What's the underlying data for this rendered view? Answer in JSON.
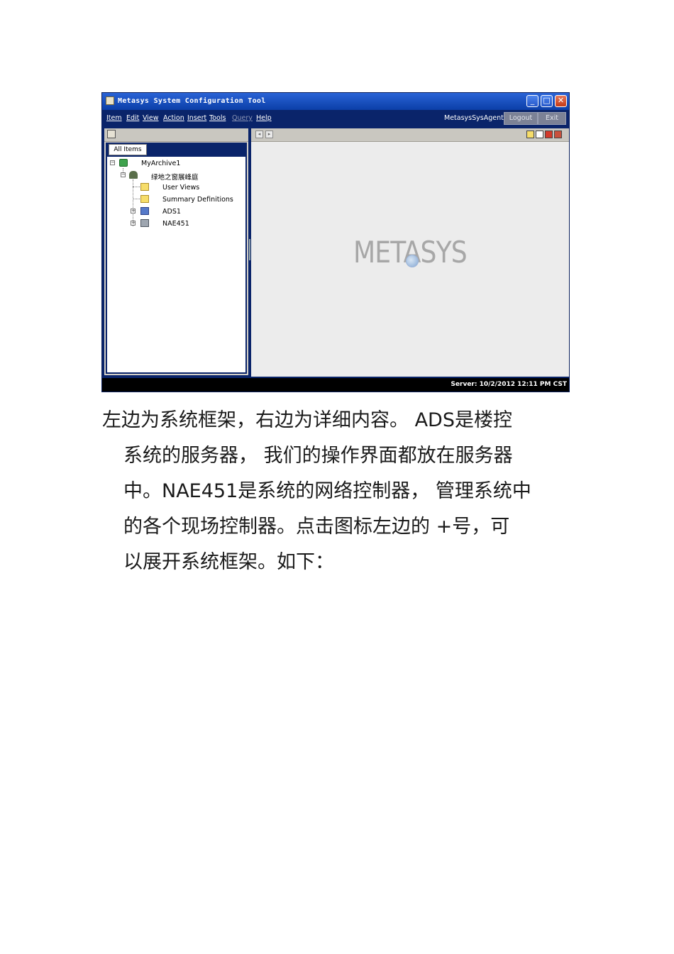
{
  "window": {
    "title": "Metasys System Configuration Tool",
    "controls": {
      "minimize": "_",
      "maximize": "□",
      "close": "✕"
    }
  },
  "menubar": {
    "items": [
      "Item",
      "Edit",
      "View",
      "Action",
      "Insert",
      "Tools",
      "Query",
      "Help"
    ],
    "disabled": [
      "Query"
    ],
    "agent": "MetasysSysAgent",
    "logout": "Logout",
    "exit": "Exit"
  },
  "navigator": {
    "tab": "All Items",
    "tree": [
      {
        "label": "MyArchive1",
        "icon": "site-icon",
        "expander": "−"
      },
      {
        "label": "绿地之窗展峰庭",
        "icon": "person-icon",
        "expander": "−"
      },
      {
        "label": "User Views",
        "icon": "folder-icon"
      },
      {
        "label": "Summary Definitions",
        "icon": "folder-icon"
      },
      {
        "label": "ADS1",
        "icon": "server-icon",
        "expander": "+"
      },
      {
        "label": "NAE451",
        "icon": "device-icon",
        "expander": "+"
      }
    ]
  },
  "content": {
    "logo": "METASYS"
  },
  "statusbar": {
    "text": "Server: 10/2/2012 12:11 PM CST"
  },
  "body_text": {
    "lines": [
      "左边为系统框架，右边为详细内容。    ADS是楼控",
      "系统的服务器，  我们的操作界面都放在服务器",
      "中。NAE451是系统的网络控制器，  管理系统中",
      "的各个现场控制器。点击图标左边的     +号，可",
      "以展开系统框架。如下："
    ]
  }
}
